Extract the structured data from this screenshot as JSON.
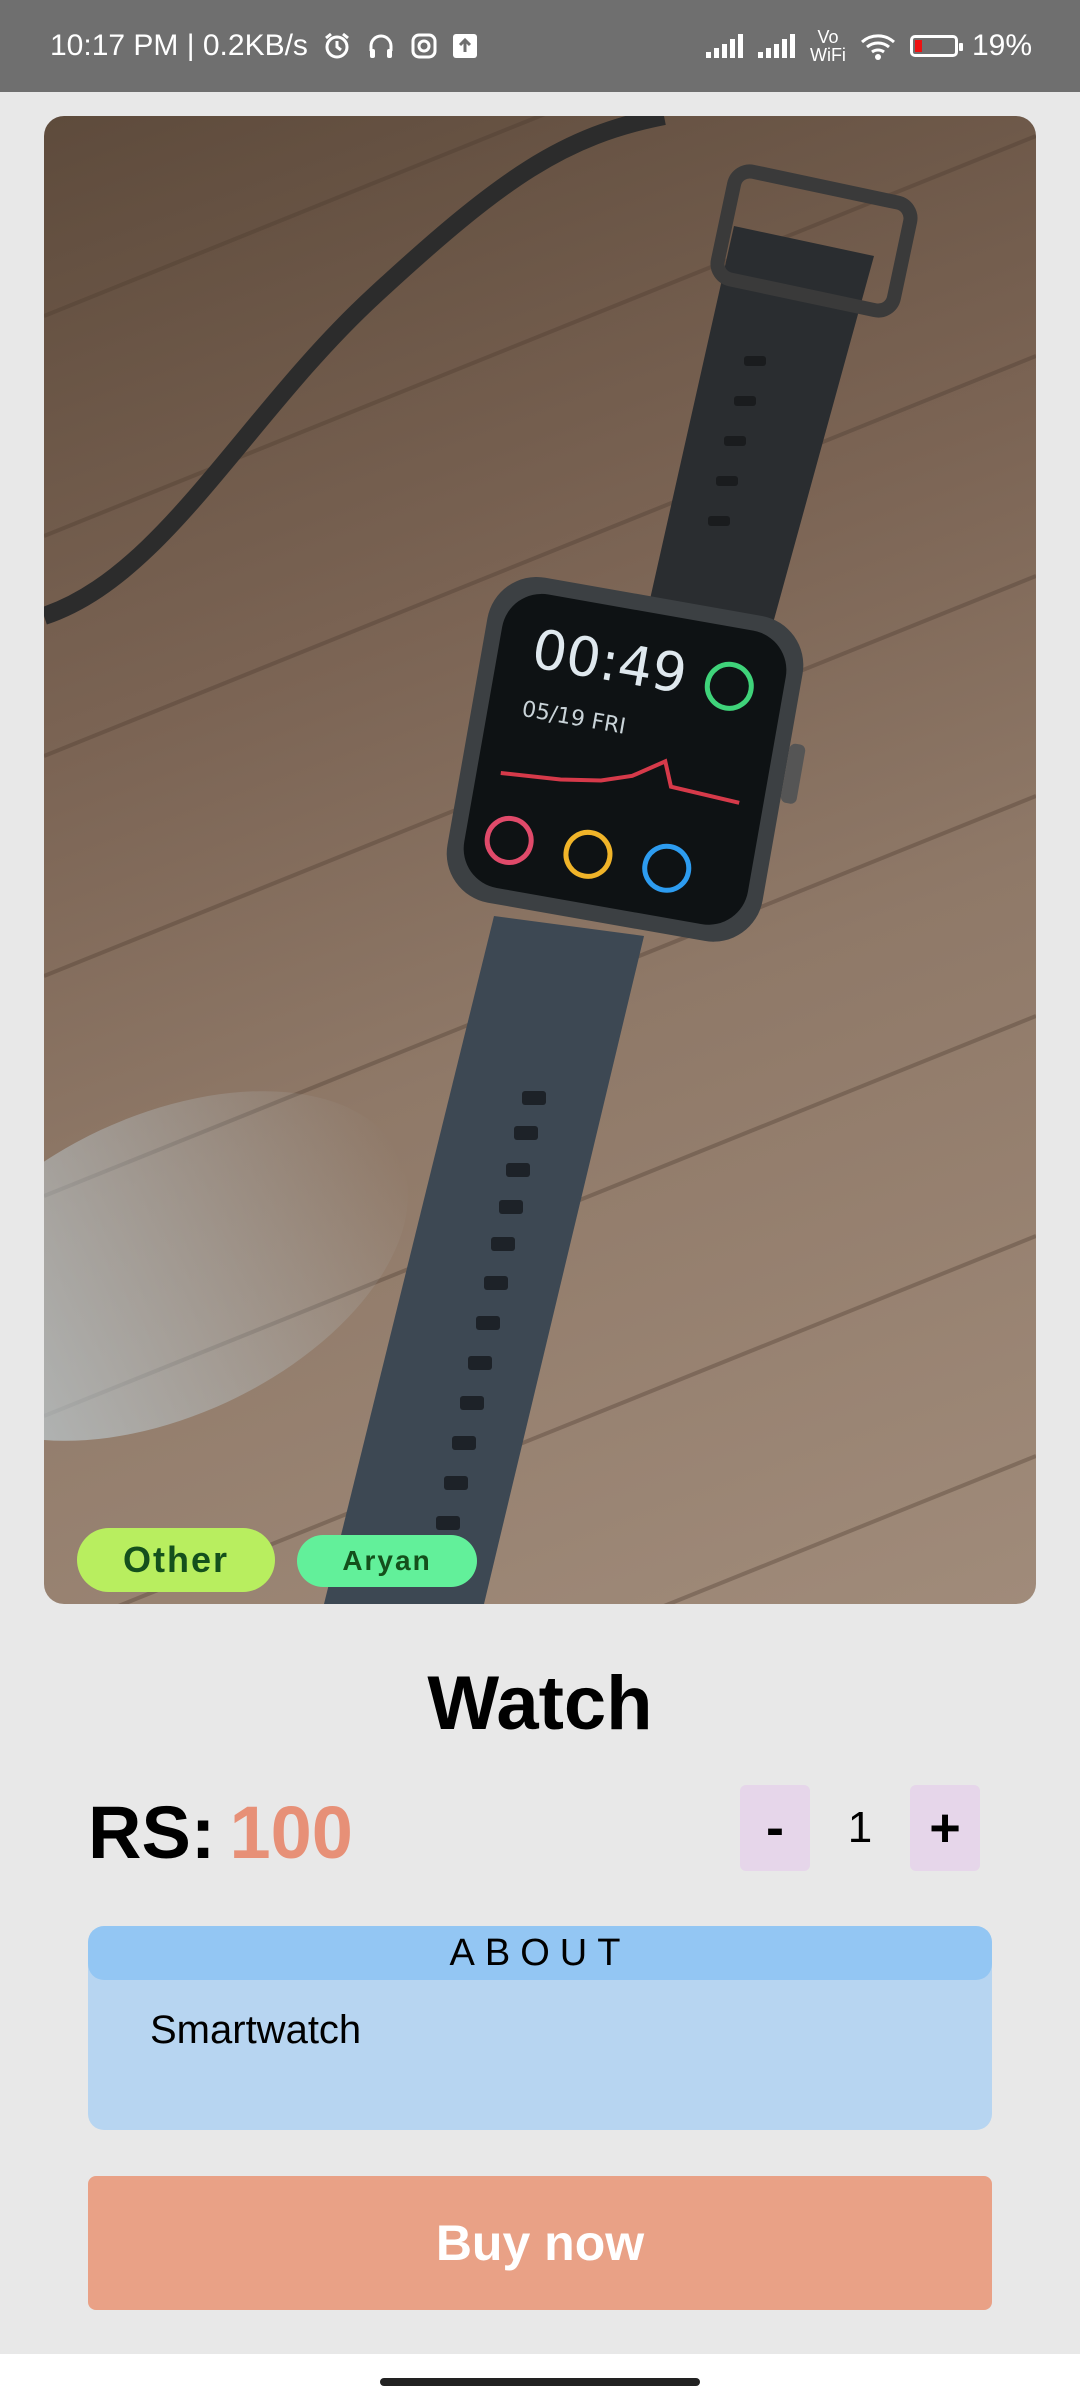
{
  "status_bar": {
    "time_speed": "10:17 PM | 0.2KB/s",
    "network": "Vo WiFi",
    "battery_percent": "19%",
    "battery_level": 0.19,
    "icons": [
      "alarm-icon",
      "headphones-icon",
      "instagram-icon",
      "upload-icon",
      "signal-icon",
      "signal-icon",
      "wifi-icon",
      "battery-icon"
    ]
  },
  "product": {
    "category_tag": "Other",
    "seller_tag": "Aryan",
    "title": "Watch",
    "price_label": "RS:",
    "price_value": "100",
    "quantity": {
      "minus_label": "-",
      "value": "1",
      "plus_label": "+"
    },
    "about": {
      "header": "ABOUT",
      "text": "Smartwatch"
    },
    "buy_label": "Buy now"
  },
  "colors": {
    "category_tag": "#b8ee5f",
    "seller_tag": "#62f09a",
    "price": "#e79077",
    "qty_button": "#e6d6ea",
    "about_header": "#93c6f3",
    "about_body": "#b7d5f1",
    "buy_button": "#e9a186"
  }
}
